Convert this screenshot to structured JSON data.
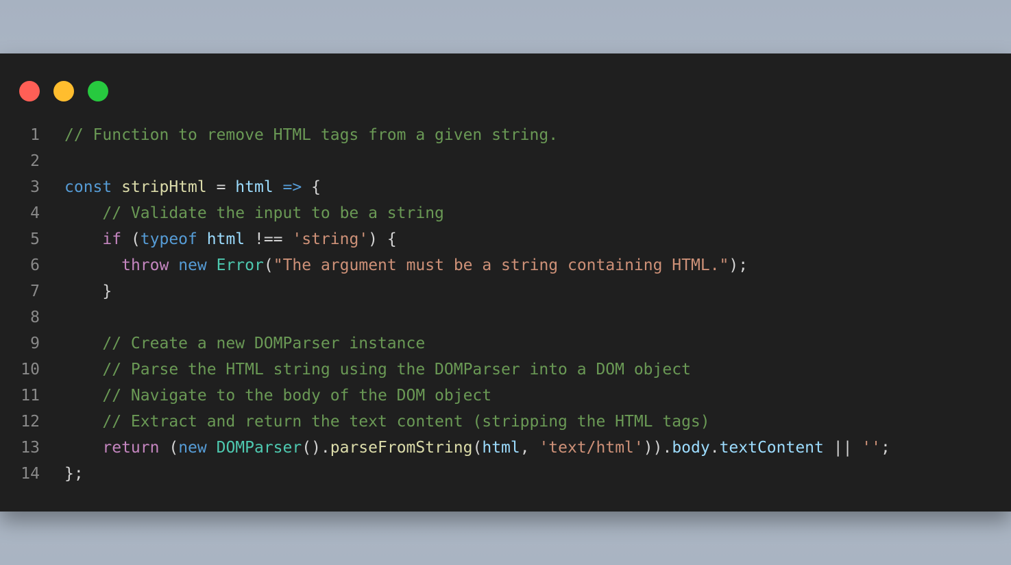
{
  "colors": {
    "background": "#aeb8c6",
    "editor_background": "#1f1f1f",
    "line_number": "#8a8a8a",
    "close_button": "#ff5f56",
    "minimize_button": "#ffbd2e",
    "maximize_button": "#27c93f",
    "comment": "#6a9955",
    "keyword": "#569cd6",
    "control": "#c586c0",
    "variable": "#9cdcfe",
    "function": "#dcdcaa",
    "class": "#4ec9b0",
    "string": "#ce9178",
    "punctuation": "#d4d4d4"
  },
  "window": {
    "buttons": [
      {
        "name": "close",
        "color": "#ff5f56"
      },
      {
        "name": "minimize",
        "color": "#ffbd2e"
      },
      {
        "name": "maximize",
        "color": "#27c93f"
      }
    ]
  },
  "code": {
    "language": "javascript",
    "lines": [
      {
        "number": "1",
        "tokens": [
          {
            "text": "// Function to remove HTML tags from a given string.",
            "type": "comment"
          }
        ]
      },
      {
        "number": "2",
        "tokens": []
      },
      {
        "number": "3",
        "tokens": [
          {
            "text": "const",
            "type": "keyword"
          },
          {
            "text": " ",
            "type": "punct"
          },
          {
            "text": "stripHtml",
            "type": "function"
          },
          {
            "text": " = ",
            "type": "punct"
          },
          {
            "text": "html",
            "type": "variable"
          },
          {
            "text": " ",
            "type": "punct"
          },
          {
            "text": "=>",
            "type": "keyword"
          },
          {
            "text": " {",
            "type": "punct"
          }
        ]
      },
      {
        "number": "4",
        "tokens": [
          {
            "text": "    ",
            "type": "punct"
          },
          {
            "text": "// Validate the input to be a string",
            "type": "comment"
          }
        ]
      },
      {
        "number": "5",
        "tokens": [
          {
            "text": "    ",
            "type": "punct"
          },
          {
            "text": "if",
            "type": "control"
          },
          {
            "text": " (",
            "type": "punct"
          },
          {
            "text": "typeof",
            "type": "keyword"
          },
          {
            "text": " ",
            "type": "punct"
          },
          {
            "text": "html",
            "type": "variable"
          },
          {
            "text": " !== ",
            "type": "punct"
          },
          {
            "text": "'string'",
            "type": "string"
          },
          {
            "text": ") {",
            "type": "punct"
          }
        ]
      },
      {
        "number": "6",
        "tokens": [
          {
            "text": "      ",
            "type": "punct"
          },
          {
            "text": "throw",
            "type": "control"
          },
          {
            "text": " ",
            "type": "punct"
          },
          {
            "text": "new",
            "type": "keyword"
          },
          {
            "text": " ",
            "type": "punct"
          },
          {
            "text": "Error",
            "type": "class"
          },
          {
            "text": "(",
            "type": "punct"
          },
          {
            "text": "\"The argument must be a string containing HTML.\"",
            "type": "string"
          },
          {
            "text": ");",
            "type": "punct"
          }
        ]
      },
      {
        "number": "7",
        "tokens": [
          {
            "text": "    }",
            "type": "punct"
          }
        ]
      },
      {
        "number": "8",
        "tokens": []
      },
      {
        "number": "9",
        "tokens": [
          {
            "text": "    ",
            "type": "punct"
          },
          {
            "text": "// Create a new DOMParser instance",
            "type": "comment"
          }
        ]
      },
      {
        "number": "10",
        "tokens": [
          {
            "text": "    ",
            "type": "punct"
          },
          {
            "text": "// Parse the HTML string using the DOMParser into a DOM object",
            "type": "comment"
          }
        ]
      },
      {
        "number": "11",
        "tokens": [
          {
            "text": "    ",
            "type": "punct"
          },
          {
            "text": "// Navigate to the body of the DOM object",
            "type": "comment"
          }
        ]
      },
      {
        "number": "12",
        "tokens": [
          {
            "text": "    ",
            "type": "punct"
          },
          {
            "text": "// Extract and return the text content (stripping the HTML tags)",
            "type": "comment"
          }
        ]
      },
      {
        "number": "13",
        "tokens": [
          {
            "text": "    ",
            "type": "punct"
          },
          {
            "text": "return",
            "type": "control"
          },
          {
            "text": " (",
            "type": "punct"
          },
          {
            "text": "new",
            "type": "keyword"
          },
          {
            "text": " ",
            "type": "punct"
          },
          {
            "text": "DOMParser",
            "type": "class"
          },
          {
            "text": "().",
            "type": "punct"
          },
          {
            "text": "parseFromString",
            "type": "function"
          },
          {
            "text": "(",
            "type": "punct"
          },
          {
            "text": "html",
            "type": "variable"
          },
          {
            "text": ", ",
            "type": "punct"
          },
          {
            "text": "'text/html'",
            "type": "string"
          },
          {
            "text": ")).",
            "type": "punct"
          },
          {
            "text": "body",
            "type": "variable"
          },
          {
            "text": ".",
            "type": "punct"
          },
          {
            "text": "textContent",
            "type": "variable"
          },
          {
            "text": " || ",
            "type": "punct"
          },
          {
            "text": "''",
            "type": "string"
          },
          {
            "text": ";",
            "type": "punct"
          }
        ]
      },
      {
        "number": "14",
        "tokens": [
          {
            "text": "};",
            "type": "punct"
          }
        ]
      }
    ]
  }
}
